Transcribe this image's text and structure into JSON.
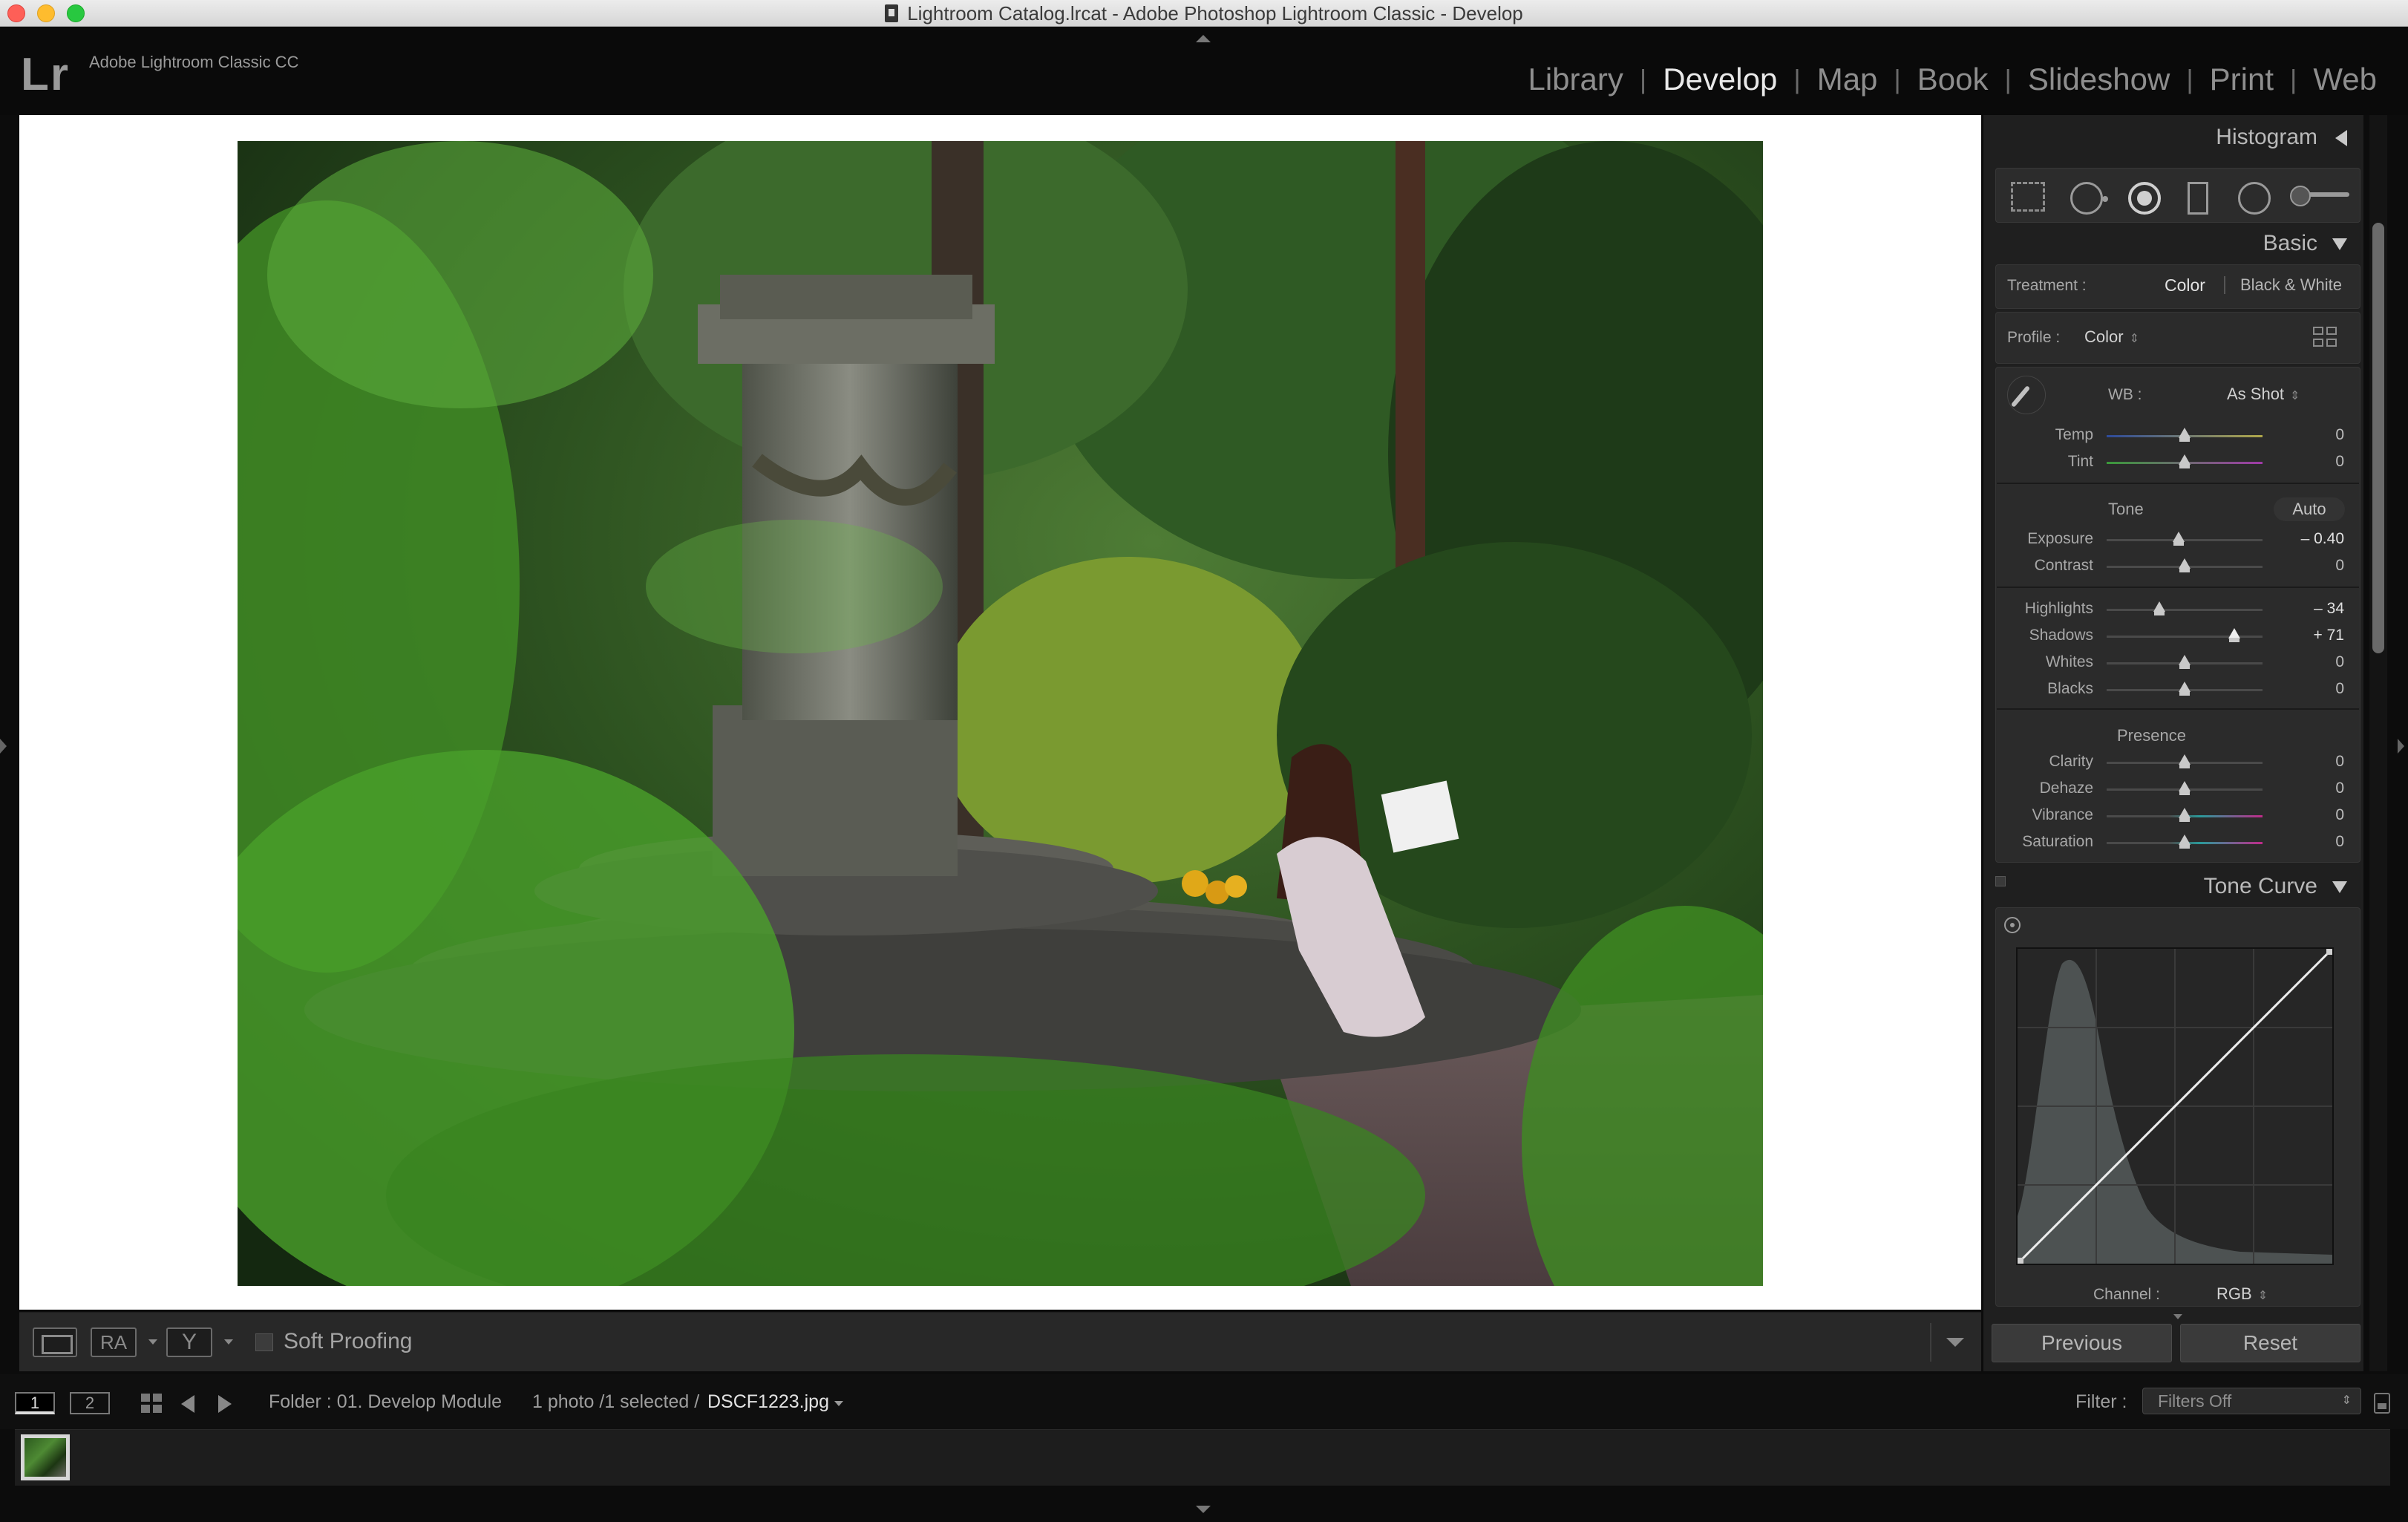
{
  "window": {
    "title": "Lightroom Catalog.lrcat - Adobe Photoshop Lightroom Classic - Develop"
  },
  "identity": {
    "logo": "Lr",
    "app_name": "Adobe Lightroom Classic CC"
  },
  "modules": {
    "items": [
      {
        "label": "Library"
      },
      {
        "label": "Develop"
      },
      {
        "label": "Map"
      },
      {
        "label": "Book"
      },
      {
        "label": "Slideshow"
      },
      {
        "label": "Print"
      },
      {
        "label": "Web"
      }
    ],
    "active": "Develop",
    "separator": "|"
  },
  "toolbar": {
    "ra_label": "RA",
    "y_label": "Y",
    "soft_proofing_label": "Soft Proofing",
    "soft_proofing_checked": false
  },
  "panels": {
    "histogram_title": "Histogram",
    "basic_title": "Basic",
    "tone_curve_title": "Tone Curve",
    "treatment": {
      "label": "Treatment :",
      "options": [
        "Color",
        "Black & White"
      ],
      "selected": "Color"
    },
    "profile": {
      "label": "Profile :",
      "value": "Color"
    },
    "wb": {
      "label": "WB :",
      "value": "As Shot"
    },
    "tone_header": "Tone",
    "auto_label": "Auto",
    "presence_header": "Presence",
    "sliders": {
      "temp": {
        "label": "Temp",
        "value": "0",
        "position": 0.5
      },
      "tint": {
        "label": "Tint",
        "value": "0",
        "position": 0.5
      },
      "exposure": {
        "label": "Exposure",
        "value": "– 0.40",
        "position": 0.46
      },
      "contrast": {
        "label": "Contrast",
        "value": "0",
        "position": 0.5
      },
      "highlights": {
        "label": "Highlights",
        "value": "– 34",
        "position": 0.34
      },
      "shadows": {
        "label": "Shadows",
        "value": "+ 71",
        "position": 0.82
      },
      "whites": {
        "label": "Whites",
        "value": "0",
        "position": 0.5
      },
      "blacks": {
        "label": "Blacks",
        "value": "0",
        "position": 0.5
      },
      "clarity": {
        "label": "Clarity",
        "value": "0",
        "position": 0.5
      },
      "dehaze": {
        "label": "Dehaze",
        "value": "0",
        "position": 0.5
      },
      "vibrance": {
        "label": "Vibrance",
        "value": "0",
        "position": 0.5
      },
      "saturation": {
        "label": "Saturation",
        "value": "0",
        "position": 0.5
      }
    },
    "channel": {
      "label": "Channel :",
      "value": "RGB"
    },
    "previous_label": "Previous",
    "reset_label": "Reset"
  },
  "filmstrip": {
    "screen1_label": "1",
    "screen2_label": "2",
    "folder_text": "Folder : 01. Develop Module",
    "count_text": "1 photo /1 selected /",
    "file_name": "DSCF1223.jpg",
    "filter_label": "Filter :",
    "filter_value": "Filters Off"
  },
  "colors": {
    "accent": "#e9e9e9",
    "panel_bg": "#1f1f1f"
  }
}
